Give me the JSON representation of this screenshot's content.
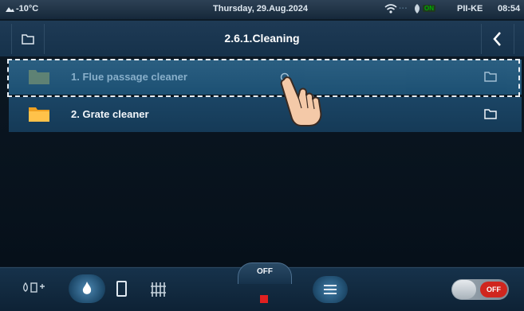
{
  "status_bar": {
    "temperature": "-10°C",
    "date": "Thursday, 29.Aug.2024",
    "wifi_signal": "···",
    "connection_badge": "ON",
    "device": "PII-KE",
    "time": "08:54"
  },
  "header": {
    "title": "2.6.1.Cleaning"
  },
  "list": {
    "items": [
      {
        "label": "1.  Flue passage cleaner",
        "selected": true
      },
      {
        "label": "2.  Grate cleaner",
        "selected": false
      }
    ]
  },
  "bottom_bar": {
    "mode_indicator": "OFF",
    "toggle_label": "OFF",
    "items": [
      "sensors-icon",
      "flame-icon",
      "boiler-icon",
      "grate-icon",
      "stop-icon",
      "menu-icon",
      "power-toggle"
    ]
  },
  "colors": {
    "accent": "#1e5478",
    "header": "#1e3a55",
    "background": "#0d1a26",
    "toggle_red": "#d0261e"
  }
}
